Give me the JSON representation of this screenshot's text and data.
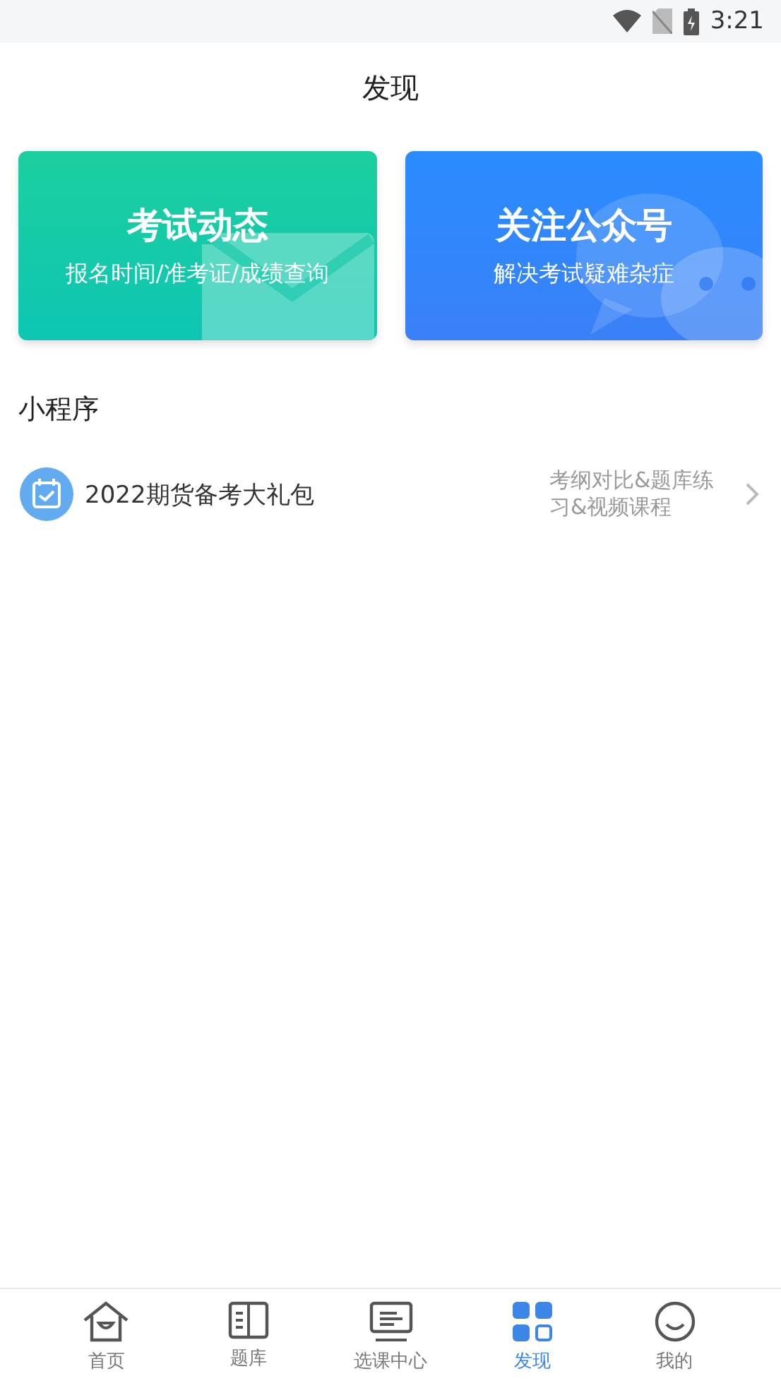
{
  "status_bar": {
    "time": "3:21"
  },
  "title": "发现",
  "cards": [
    {
      "kind": "exam",
      "title": "考试动态",
      "subtitle": "报名时间/准考证/成绩查询"
    },
    {
      "kind": "wechat",
      "title": "关注公众号",
      "subtitle": "解决考试疑难杂症"
    }
  ],
  "section_title": "小程序",
  "mini_programs": [
    {
      "name": "2022期货备考大礼包",
      "description": "考纲对比&题库练习&视频课程"
    }
  ],
  "tabs": [
    {
      "kind": "home",
      "label": "首页",
      "selected": false
    },
    {
      "kind": "book",
      "label": "题库",
      "selected": false
    },
    {
      "kind": "monitor",
      "label": "选课中心",
      "selected": false
    },
    {
      "kind": "grid",
      "label": "发现",
      "selected": true
    },
    {
      "kind": "face",
      "label": "我的",
      "selected": false
    }
  ]
}
